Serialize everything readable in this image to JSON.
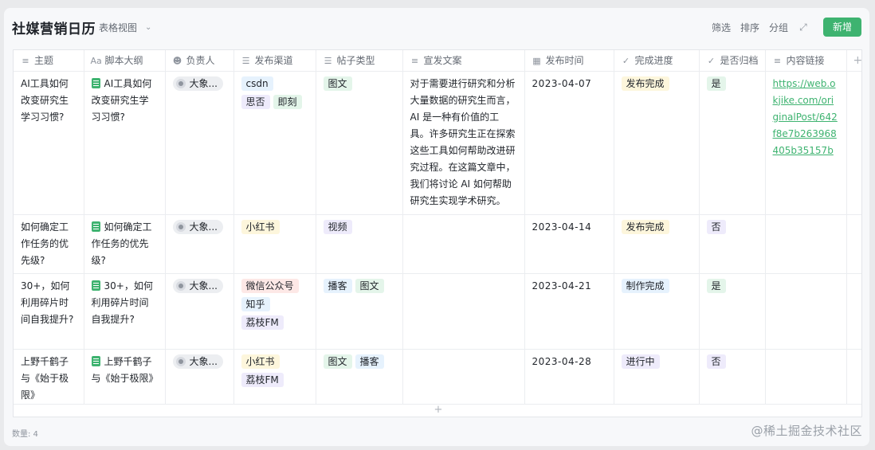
{
  "toolbar": {
    "title": "社媒营销日历",
    "view_label": "表格视图",
    "filter": "筛选",
    "sort": "排序",
    "group": "分组",
    "add": "新增"
  },
  "columns": {
    "topic": "主题",
    "outline": "脚本大纲",
    "owner": "负责人",
    "channel": "发布渠道",
    "post_type": "帖子类型",
    "copy": "宣发文案",
    "publish_time": "发布时间",
    "progress": "完成进度",
    "archived": "是否归档",
    "link": "内容链接"
  },
  "rows": [
    {
      "topic": "AI工具如何改变研究生学习习惯?",
      "outline": "AI工具如何改变研究生学习习惯?",
      "owner": "大象...",
      "channels": [
        "csdn",
        "思否",
        "即刻"
      ],
      "post_types": [
        "图文"
      ],
      "copy": "对于需要进行研究和分析大量数据的研究生而言，AI 是一种有价值的工具。许多研究生正在探索这些工具如何帮助改进研究过程。在这篇文章中，我们将讨论 AI 如何帮助研究生实现学术研究。",
      "publish_time": "2023-04-07",
      "progress": "发布完成",
      "archived": "是",
      "link": "https://web.okjike.com/originalPost/642f8e7b263968405b35157b"
    },
    {
      "topic": "如何确定工作任务的优先级?",
      "outline": "如何确定工作任务的优先级?",
      "owner": "大象...",
      "channels": [
        "小红书"
      ],
      "post_types": [
        "视频"
      ],
      "copy": "",
      "publish_time": "2023-04-14",
      "progress": "发布完成",
      "archived": "否",
      "link": ""
    },
    {
      "topic": "30+，如何利用碎片时间自我提升?",
      "outline": "30+，如何利用碎片时间自我提升?",
      "owner": "大象...",
      "channels": [
        "微信公众号",
        "知乎",
        "荔枝FM"
      ],
      "post_types": [
        "播客",
        "图文"
      ],
      "copy": "",
      "publish_time": "2023-04-21",
      "progress": "制作完成",
      "archived": "是",
      "link": ""
    },
    {
      "topic": "上野千鹤子与《始于极限》",
      "outline": "上野千鹤子与《始于极限》",
      "owner": "大象...",
      "channels": [
        "小红书",
        "荔枝FM"
      ],
      "post_types": [
        "图文",
        "播客"
      ],
      "copy": "",
      "publish_time": "2023-04-28",
      "progress": "进行中",
      "archived": "否",
      "link": ""
    }
  ],
  "footer": {
    "count": "数量: 4",
    "watermark": "@稀土掘金技术社区"
  },
  "icons": {
    "topic": "text-lines-icon",
    "outline": "text-format-icon",
    "owner": "people-icon",
    "channel": "list-check-icon",
    "post_type": "list-check-icon",
    "copy": "text-lines-icon",
    "publish_time": "calendar-icon",
    "progress": "check-circle-icon",
    "archived": "check-circle-icon",
    "link": "text-lines-icon"
  },
  "colors": {
    "accent": "#3eb370",
    "tag_blue": "#e6f2fd",
    "tag_purple": "#eeebfb",
    "tag_green": "#e4f5ea",
    "tag_yellow": "#fdf6dc",
    "tag_pink": "#fde8e6"
  }
}
